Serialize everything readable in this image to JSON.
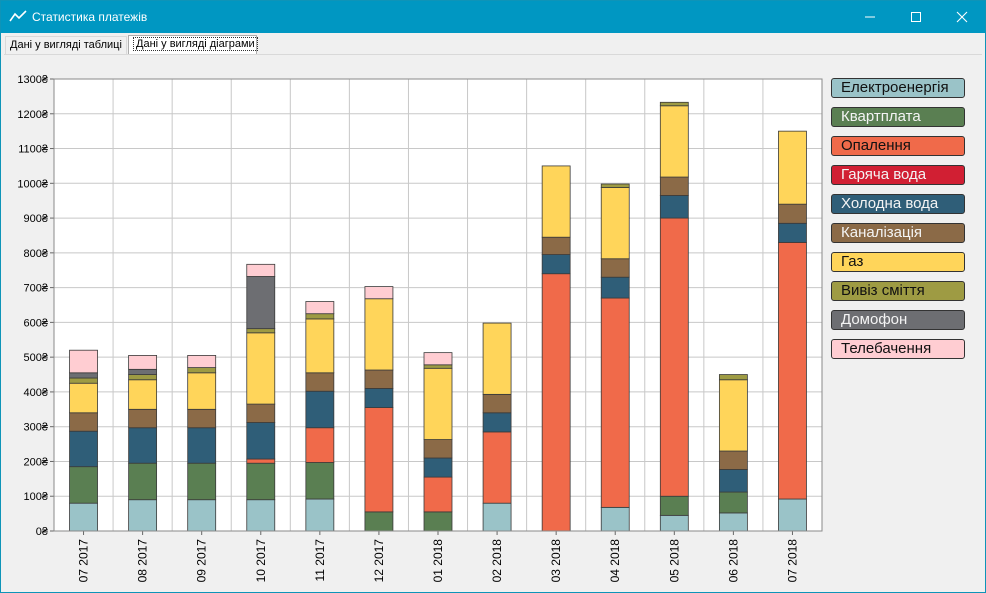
{
  "window": {
    "title": "Статистика платежів",
    "icon": "chart-line-icon",
    "controls": [
      "minimize-icon",
      "maximize-icon",
      "close-icon"
    ]
  },
  "tabs": [
    {
      "label": "Дані у вигляді таблиці",
      "active": false
    },
    {
      "label": "Дані у вигляді діаграми",
      "active": true
    }
  ],
  "chart_data": {
    "type": "bar",
    "stacked": true,
    "currency_suffix": "₴",
    "ylim": [
      0,
      1300
    ],
    "y_ticks": [
      "0₴",
      "100₴",
      "200₴",
      "300₴",
      "400₴",
      "500₴",
      "600₴",
      "700₴",
      "800₴",
      "900₴",
      "1000₴",
      "1100₴",
      "1200₴",
      "1300₴"
    ],
    "grid": true,
    "legend_position": "right",
    "categories": [
      "07 2017",
      "08 2017",
      "09 2017",
      "10 2017",
      "11 2017",
      "12 2017",
      "01 2018",
      "02 2018",
      "03 2018",
      "04 2018",
      "05 2018",
      "06 2018",
      "07 2018"
    ],
    "series": [
      {
        "name": "Електроенергія",
        "color": "#9ac3c8",
        "values": [
          80,
          90,
          90,
          90,
          92,
          0,
          0,
          80,
          0,
          68,
          45,
          52,
          92
        ]
      },
      {
        "name": "Квартплата",
        "color": "#5a7f52",
        "values": [
          105,
          105,
          105,
          105,
          105,
          55,
          55,
          0,
          0,
          0,
          55,
          60,
          0
        ]
      },
      {
        "name": "Опалення",
        "color": "#f06a4a",
        "values": [
          0,
          0,
          0,
          12,
          100,
          300,
          100,
          205,
          740,
          602,
          800,
          0,
          738
        ]
      },
      {
        "name": "Гаряча вода",
        "color": "#d11f33",
        "values": [
          0,
          0,
          0,
          0,
          0,
          0,
          0,
          0,
          0,
          0,
          0,
          0,
          0
        ]
      },
      {
        "name": "Холодна вода",
        "color": "#2f5e78",
        "values": [
          102,
          102,
          102,
          105,
          105,
          55,
          55,
          55,
          55,
          60,
          65,
          65,
          55
        ]
      },
      {
        "name": "Каналізація",
        "color": "#8b6a47",
        "values": [
          53,
          53,
          53,
          53,
          53,
          53,
          53,
          53,
          50,
          53,
          53,
          53,
          55
        ]
      },
      {
        "name": "Газ",
        "color": "#ffd55a",
        "values": [
          85,
          85,
          105,
          205,
          155,
          205,
          205,
          205,
          205,
          205,
          205,
          205,
          210
        ]
      },
      {
        "name": "Вивіз сміття",
        "color": "#9e9b43",
        "values": [
          15,
          15,
          15,
          12,
          15,
          0,
          10,
          0,
          0,
          10,
          10,
          15,
          0
        ]
      },
      {
        "name": "Домофон",
        "color": "#6d6e72",
        "values": [
          15,
          15,
          0,
          150,
          0,
          0,
          0,
          0,
          0,
          0,
          0,
          0,
          0
        ]
      },
      {
        "name": "Телебачення",
        "color": "#ffcdd2",
        "values": [
          65,
          40,
          35,
          35,
          35,
          35,
          35,
          0,
          0,
          0,
          0,
          0,
          0
        ]
      }
    ]
  }
}
